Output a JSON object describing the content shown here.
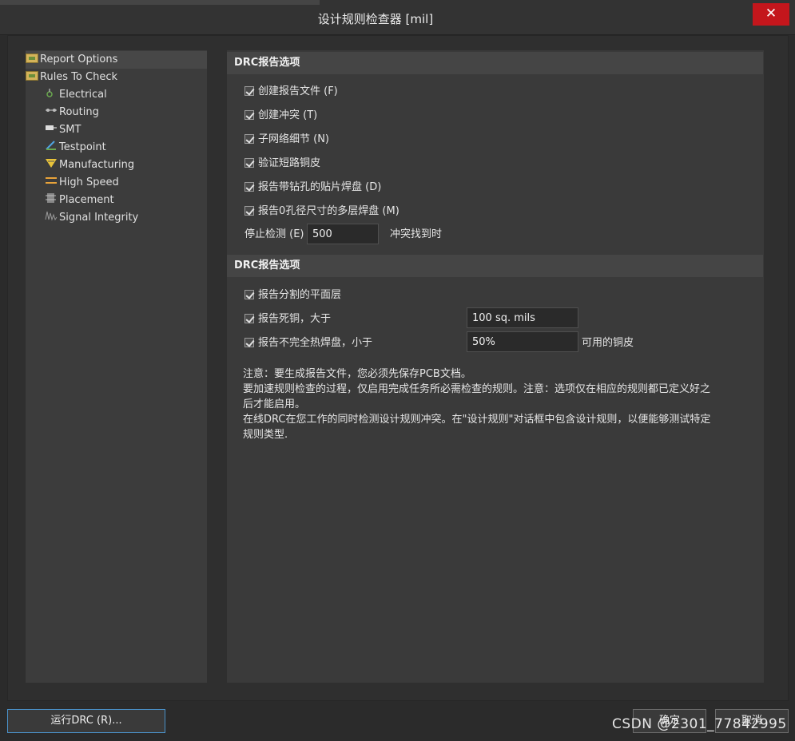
{
  "window": {
    "title": "设计规则检查器 [mil]",
    "close_label": "✕"
  },
  "tree": {
    "items": [
      {
        "label": "Report Options",
        "icon": "folder-icon"
      },
      {
        "label": "Rules To Check",
        "icon": "folder-icon"
      },
      {
        "label": "Electrical",
        "icon": "electrical-icon"
      },
      {
        "label": "Routing",
        "icon": "routing-icon"
      },
      {
        "label": "SMT",
        "icon": "smt-icon"
      },
      {
        "label": "Testpoint",
        "icon": "testpoint-icon"
      },
      {
        "label": "Manufacturing",
        "icon": "manufacturing-icon"
      },
      {
        "label": "High Speed",
        "icon": "high-speed-icon"
      },
      {
        "label": "Placement",
        "icon": "placement-icon"
      },
      {
        "label": "Signal Integrity",
        "icon": "signal-integrity-icon"
      }
    ],
    "selected": "Report Options"
  },
  "section1": {
    "header": "DRC报告选项",
    "options": [
      {
        "label": "创建报告文件 (F)",
        "checked": true
      },
      {
        "label": "创建冲突 (T)",
        "checked": true
      },
      {
        "label": "子网络细节 (N)",
        "checked": true
      },
      {
        "label": "验证短路铜皮",
        "checked": true
      },
      {
        "label": "报告带钻孔的贴片焊盘 (D)",
        "checked": true
      },
      {
        "label": "报告0孔径尺寸的多层焊盘 (M)",
        "checked": true
      }
    ],
    "stop_label": "停止检测 (E)",
    "stop_value": "500",
    "stop_suffix": "冲突找到时"
  },
  "section2": {
    "header": "DRC报告选项",
    "options": [
      {
        "label": "报告分割的平面层",
        "checked": true
      },
      {
        "label": "报告死铜，大于",
        "checked": true,
        "value": "100 sq. mils"
      },
      {
        "label": "报告不完全热焊盘，小于",
        "checked": true,
        "value": "50%"
      }
    ],
    "thermal_suffix": "可用的铜皮"
  },
  "note": {
    "lines": [
      "注意：要生成报告文件，您必须先保存PCB文档。",
      "要加速规则检查的过程，仅启用完成任务所必需检查的规则。注意：选项仅在相应的规则都已定义好之",
      "后才能启用。",
      "在线DRC在您工作的同时检测设计规则冲突。在\"设计规则\"对话框中包含设计规则，以便能够测试特定",
      "规则类型."
    ]
  },
  "buttons": {
    "run": "运行DRC (R)...",
    "ok": "确定",
    "cancel": "取消"
  },
  "watermark": "CSDN @2301_77842995",
  "colors": {
    "close": "#c4161c",
    "run_border": "#4a90c8",
    "background": "#2b2b2b"
  }
}
